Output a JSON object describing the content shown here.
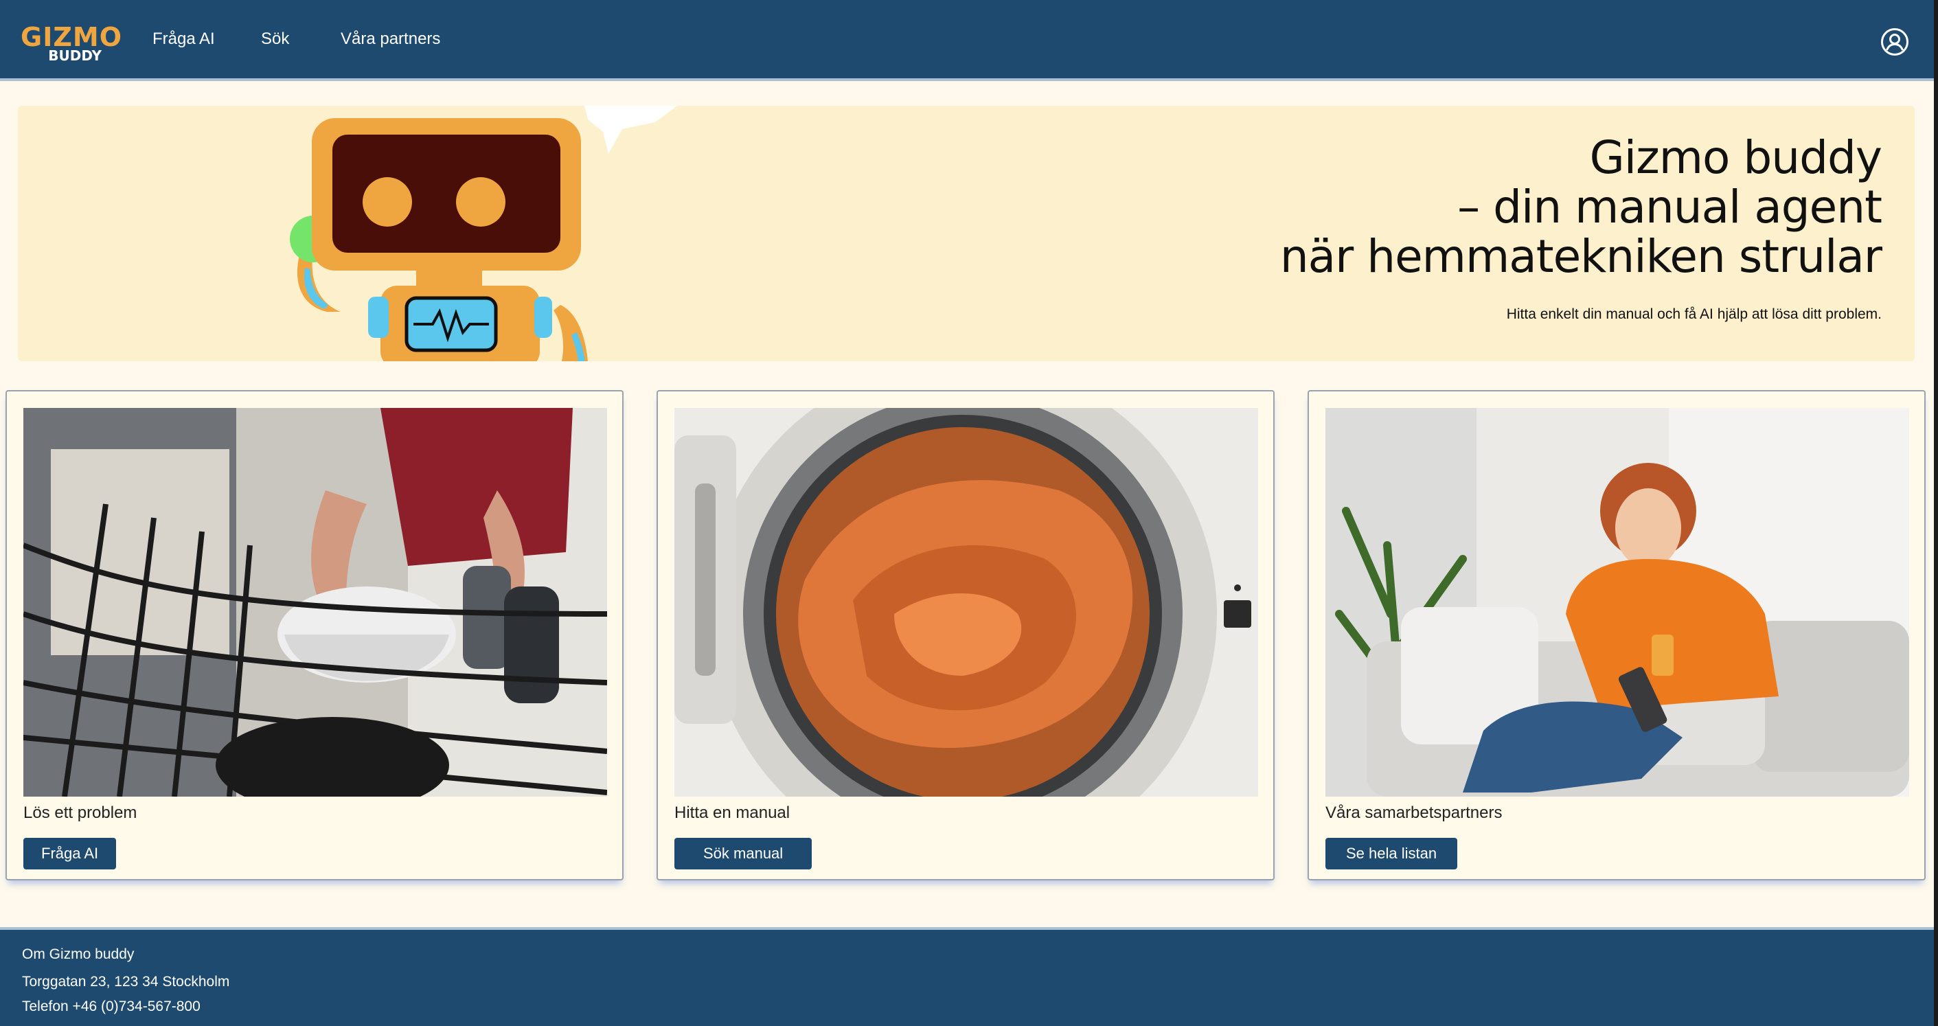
{
  "header": {
    "logo": {
      "line1": "GIZMO",
      "line2": "BUDDY"
    },
    "nav": [
      {
        "label": "Fråga AI"
      },
      {
        "label": "Sök"
      },
      {
        "label": "Våra partners"
      }
    ],
    "user_icon": "user-circle-icon"
  },
  "hero": {
    "title_lines": [
      "Gizmo buddy",
      "– din manual agent",
      "när hemmatekniken strular"
    ],
    "subtitle": "Hitta enkelt din manual och få AI hjälp att lösa ditt problem.",
    "illustration": "robot-mascot"
  },
  "cards": [
    {
      "image": "dishwasher-photo",
      "label": "Lös ett problem",
      "button": "Fråga AI"
    },
    {
      "image": "washing-machine-photo",
      "label": "Hitta en manual",
      "button": "Sök manual"
    },
    {
      "image": "woman-remote-photo",
      "label": "Våra samarbetspartners",
      "button": "Se hela listan"
    }
  ],
  "footer": {
    "lines": [
      "Om Gizmo buddy",
      "Torggatan 23, 123 34 Stockholm",
      "Telefon +46 (0)734-567-800"
    ]
  },
  "colors": {
    "brand_navy": "#1d4a6e",
    "accent_orange": "#f0a640",
    "hero_bg": "#fdf0cd",
    "page_bg": "#fef9ec"
  }
}
